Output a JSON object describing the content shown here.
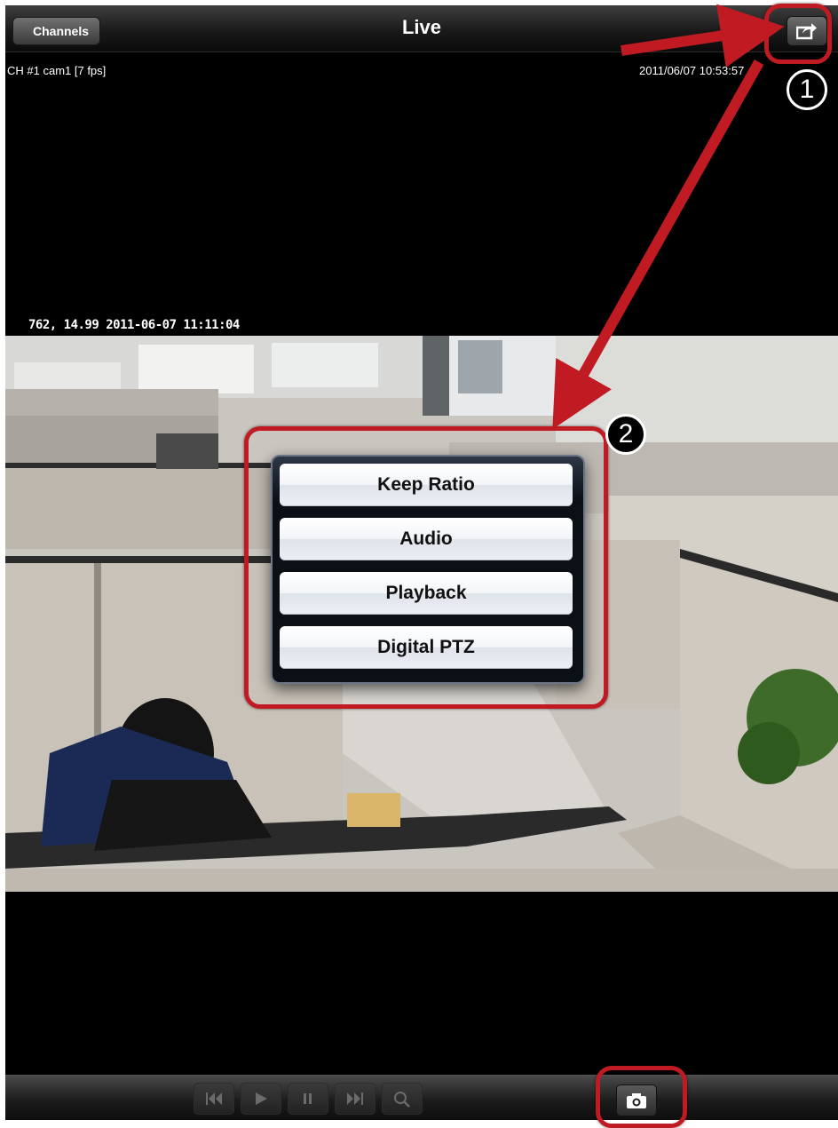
{
  "navbar": {
    "back_label": "Channels",
    "title": "Live",
    "share_icon": "share-icon"
  },
  "video": {
    "channel_info": "CH #1 cam1 [7 fps]",
    "datetime": "2011/06/07 10:53:57",
    "camera_stamp": "762, 14.99 2011-06-07 11:11:04"
  },
  "popover": {
    "items": [
      {
        "label": "Keep Ratio"
      },
      {
        "label": "Audio"
      },
      {
        "label": "Playback"
      },
      {
        "label": "Digital PTZ"
      }
    ]
  },
  "annotations": {
    "badge_1": "1",
    "badge_2": "2",
    "color": "#c01b22"
  },
  "toolbar": {
    "playback_buttons": [
      "skip-back-icon",
      "play-icon",
      "pause-icon",
      "skip-forward-icon",
      "zoom-icon"
    ],
    "snapshot_icon": "camera-icon"
  }
}
